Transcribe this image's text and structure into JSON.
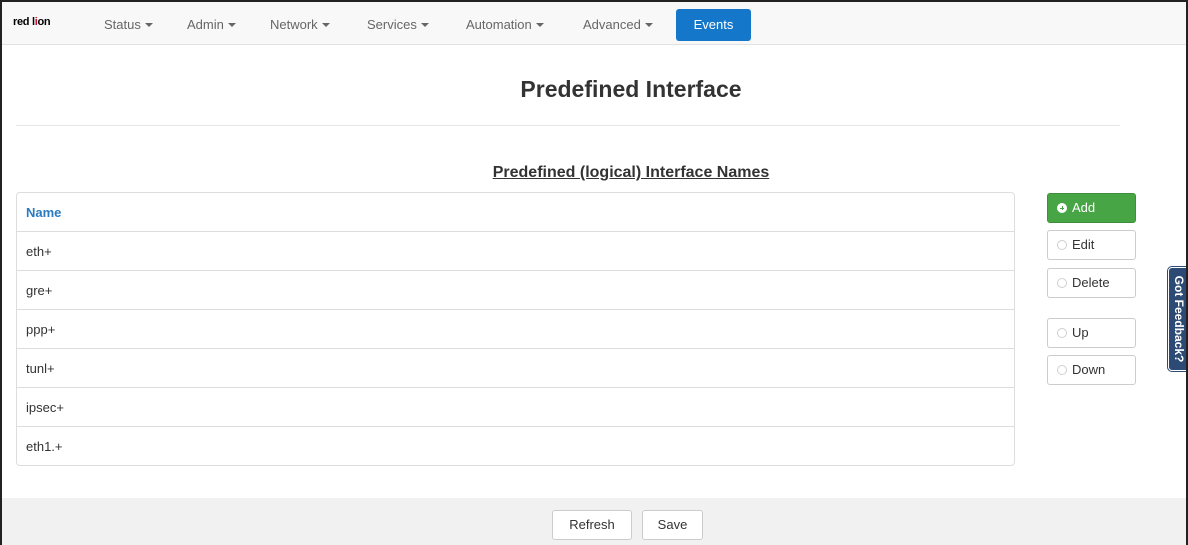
{
  "navbar": {
    "brand": {
      "part1": "red l",
      "o": "i",
      "part2": "on"
    },
    "items": [
      {
        "label": "Status"
      },
      {
        "label": "Admin"
      },
      {
        "label": "Network"
      },
      {
        "label": "Services"
      },
      {
        "label": "Automation"
      },
      {
        "label": "Advanced"
      }
    ],
    "active": "Events",
    "active_color": "#1577c9"
  },
  "page_title": "Predefined Interface",
  "section_title": "Predefined (logical) Interface Names",
  "table": {
    "header": "Name",
    "header_color": "#2a7bc0",
    "rows": [
      "eth+",
      "gre+",
      "ppp+",
      "tunl+",
      "ipsec+",
      "eth1.+"
    ]
  },
  "actions": {
    "add": {
      "label": "Add",
      "icon": "plus-circle-icon",
      "color": "#48a545"
    },
    "edit": {
      "label": "Edit",
      "icon": "edit-icon"
    },
    "delete": {
      "label": "Delete",
      "icon": "minus-circle-icon"
    },
    "up": {
      "label": "Up",
      "icon": "arrow-up-icon"
    },
    "down": {
      "label": "Down",
      "icon": "arrow-down-icon"
    }
  },
  "feedback": {
    "label": "Got Feedback?",
    "color": "#2c4a74"
  },
  "footer": {
    "refresh": "Refresh",
    "save": "Save"
  }
}
